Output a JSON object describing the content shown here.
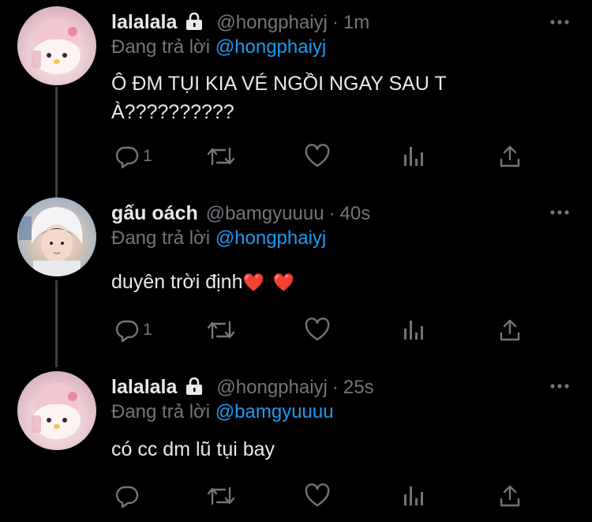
{
  "tweets": [
    {
      "name": "lalalala",
      "protected": true,
      "handle": "@hongphaiyj",
      "separator": "·",
      "time": "1m",
      "reply_prefix": "Đang trả lời",
      "reply_to": "@hongphaiyj",
      "text_line1": "Ô ĐM TỤI KIA VÉ NGỒI NGAY SAU T",
      "text_line2": "À??????????",
      "reply_count": "1",
      "avatar": "my-melody-avatar"
    },
    {
      "name": "gấu oách",
      "protected": false,
      "handle": "@bamgyuuuu",
      "separator": "·",
      "time": "40s",
      "reply_prefix": "Đang trả lời",
      "reply_to": "@hongphaiyj",
      "text": "duyên trời định",
      "emoji1": "❤️",
      "emoji2": "❤️",
      "reply_count": "1",
      "avatar": "boy-in-white-hood-avatar"
    },
    {
      "name": "lalalala",
      "protected": true,
      "handle": "@hongphaiyj",
      "separator": "·",
      "time": "25s",
      "reply_prefix": "Đang trả lời",
      "reply_to": "@bamgyuuuu",
      "text": "có cc dm lũ tụi bay",
      "reply_count": "",
      "avatar": "my-melody-avatar"
    }
  ],
  "colors": {
    "background": "#000000",
    "text": "#e7e9ea",
    "muted": "#71767b",
    "link": "#1d9bf0",
    "thread_line": "#3a3f44"
  },
  "icons": [
    "reply-icon",
    "retweet-icon",
    "like-icon",
    "analytics-icon",
    "share-icon",
    "more-icon",
    "lock-icon"
  ]
}
